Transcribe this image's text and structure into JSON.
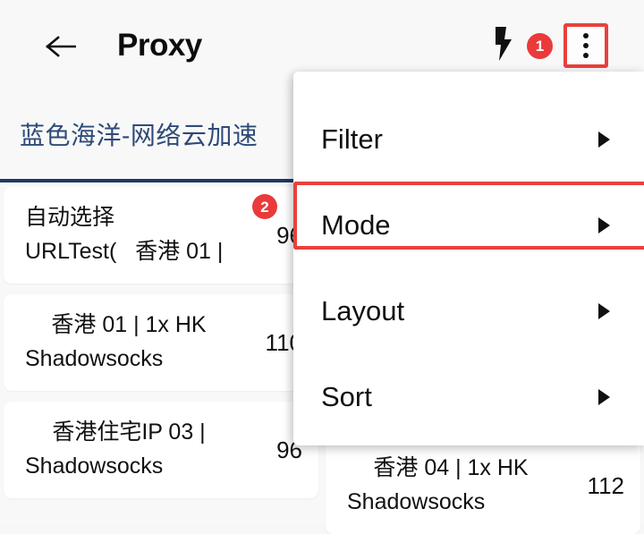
{
  "appbar": {
    "back_icon": "arrow-left-icon",
    "title": "Proxy",
    "bolt_icon": "lightning-bolt-icon",
    "badge_count": "1",
    "overflow_icon": "more-vertical-icon"
  },
  "tabs": [
    {
      "label": "蓝色海洋-网络云加速",
      "selected": true
    }
  ],
  "proxies": [
    {
      "name": "自动选择",
      "sub": "URLTest(   香港 01 |",
      "delay": "96",
      "badge": "2",
      "column": "left",
      "row": 1
    },
    {
      "name": "香港 01 | 1x HK",
      "sub": "Shadowsocks",
      "delay": "110",
      "badge": "",
      "column": "left",
      "row": 2
    },
    {
      "name": "香港住宅IP 03 |",
      "sub": "Shadowsocks",
      "delay": "96",
      "badge": "",
      "column": "left",
      "row": 3
    },
    {
      "name": "香港 04 | 1x HK",
      "sub": "Shadowsocks",
      "delay": "112",
      "badge": "",
      "column": "right",
      "row": 4
    }
  ],
  "menu": {
    "items": [
      {
        "label": "Filter",
        "arrow": "triangle-right-icon",
        "highlighted": false
      },
      {
        "label": "Mode",
        "arrow": "triangle-right-icon",
        "highlighted": true
      },
      {
        "label": "Layout",
        "arrow": "triangle-right-icon",
        "highlighted": false
      },
      {
        "label": "Sort",
        "arrow": "triangle-right-icon",
        "highlighted": false
      }
    ]
  },
  "colors": {
    "accent_red": "#e8413d",
    "badge_red": "#ea3a3a",
    "tab_blue": "#2e4a78",
    "tab_underline": "#1e3a61",
    "background": "#f8f8f8",
    "card": "#ffffff"
  }
}
